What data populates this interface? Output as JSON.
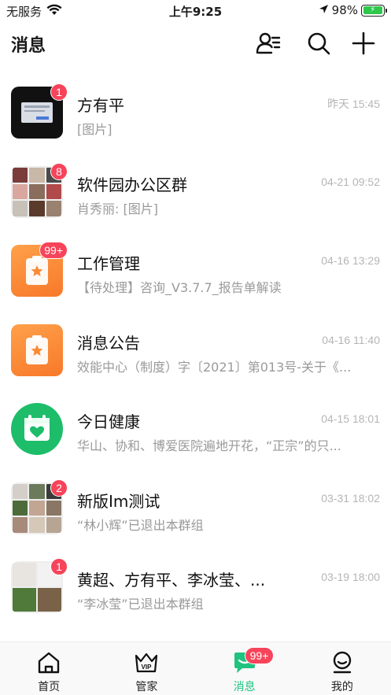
{
  "status_bar": {
    "carrier": "无服务",
    "time": "上午9:25",
    "battery": "98%",
    "battery_level": 0.98
  },
  "header": {
    "title": "消息",
    "icons": [
      "contacts-icon",
      "search-icon",
      "plus-icon"
    ]
  },
  "conversations": [
    {
      "name": "方有平",
      "time": "昨天 15:45",
      "preview": "[图片]",
      "badge": "1",
      "avatar": "photo-dark"
    },
    {
      "name": "软件园办公区群",
      "time": "04-21 09:52",
      "preview": "肖秀丽: [图片]",
      "badge": "8",
      "avatar": "group-grid"
    },
    {
      "name": "工作管理",
      "time": "04-16 13:29",
      "preview": "【待处理】咨询_V3.7.7_报告单解读",
      "badge": "99+",
      "avatar": "orange-clipboard"
    },
    {
      "name": "消息公告",
      "time": "04-16 11:40",
      "preview": "效能中心（制度）字〔2021〕第013号-关于《...",
      "badge": "",
      "avatar": "orange-clipboard"
    },
    {
      "name": "今日健康",
      "time": "04-15 18:01",
      "preview": "华山、协和、博爱医院遍地开花，“正宗”的只...",
      "badge": "",
      "avatar": "green-calendar"
    },
    {
      "name": "新版Im测试",
      "time": "03-31 18:02",
      "preview": "“林小辉”已退出本群组",
      "badge": "2",
      "avatar": "group-grid"
    },
    {
      "name": "黄超、方有平、李冰莹、...",
      "time": "03-19 18:00",
      "preview": "“李冰莹”已退出本群组",
      "badge": "1",
      "avatar": "group-grid-2"
    }
  ],
  "tab_bar": {
    "tabs": [
      {
        "label": "首页",
        "icon": "home-icon",
        "active": false
      },
      {
        "label": "管家",
        "icon": "vip-crown-icon",
        "active": false
      },
      {
        "label": "消息",
        "icon": "message-icon",
        "active": true,
        "badge": "99+"
      },
      {
        "label": "我的",
        "icon": "profile-icon",
        "active": false
      }
    ]
  },
  "colors": {
    "accent": "#1fc37f",
    "badge": "#f7445a",
    "orange": "#fb8a36",
    "green": "#1dbd6a"
  }
}
